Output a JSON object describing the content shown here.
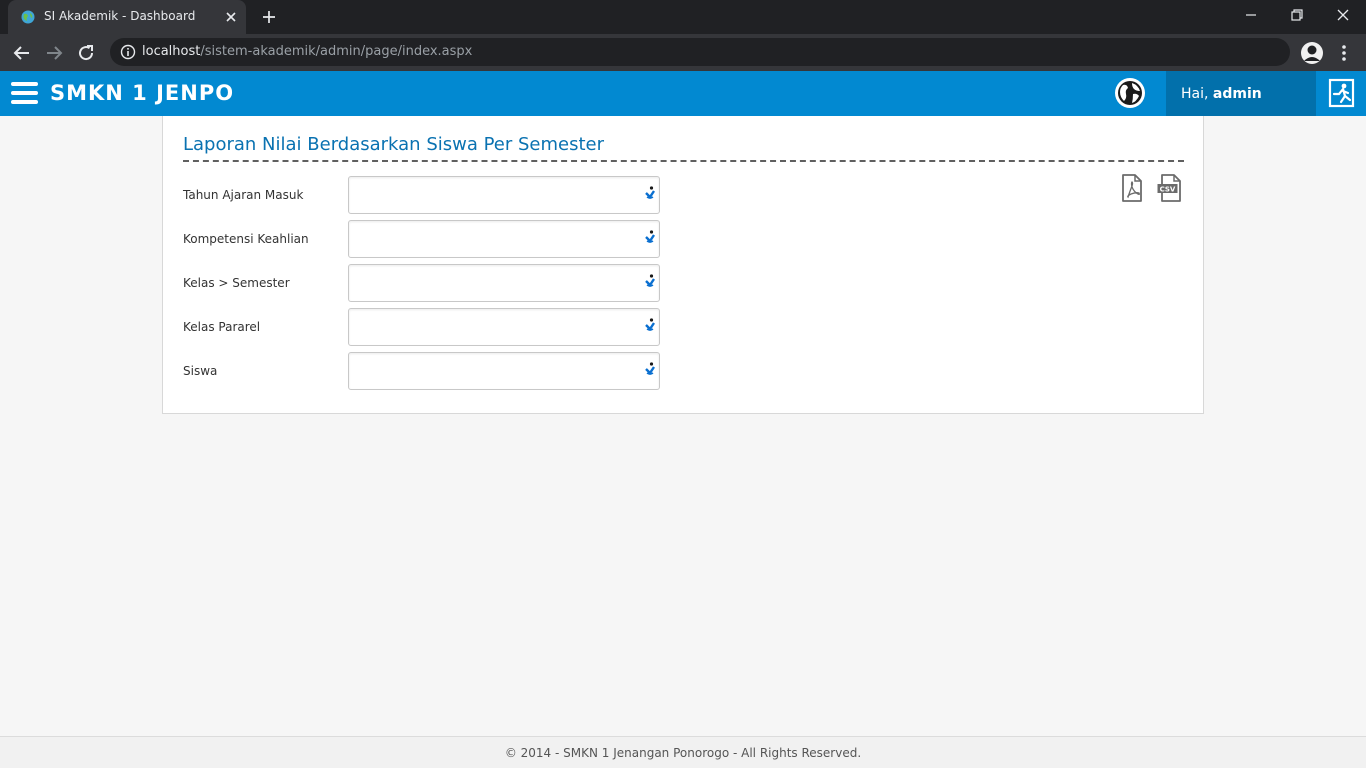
{
  "browser": {
    "tab_title": "SI Akademik - Dashboard",
    "url_host": "localhost",
    "url_path": "/sistem-akademik/admin/page/index.aspx"
  },
  "header": {
    "brand": "SMKN 1 JENPO",
    "greeting_prefix": "Hai, ",
    "username": "admin"
  },
  "report": {
    "title": "Laporan Nilai Berdasarkan Siswa Per Semester",
    "fields": [
      {
        "label": "Tahun Ajaran Masuk",
        "value": ""
      },
      {
        "label": "Kompetensi Keahlian",
        "value": ""
      },
      {
        "label": "Kelas > Semester",
        "value": ""
      },
      {
        "label": "Kelas Pararel",
        "value": ""
      },
      {
        "label": "Siswa",
        "value": ""
      }
    ],
    "export_csv_text": "CSV"
  },
  "footer": {
    "text": "© 2014 - SMKN 1 Jenangan Ponorogo - All Rights Reserved."
  },
  "colors": {
    "accent": "#0289d1",
    "accent_dark": "#0270ab",
    "title": "#0a72b1"
  }
}
